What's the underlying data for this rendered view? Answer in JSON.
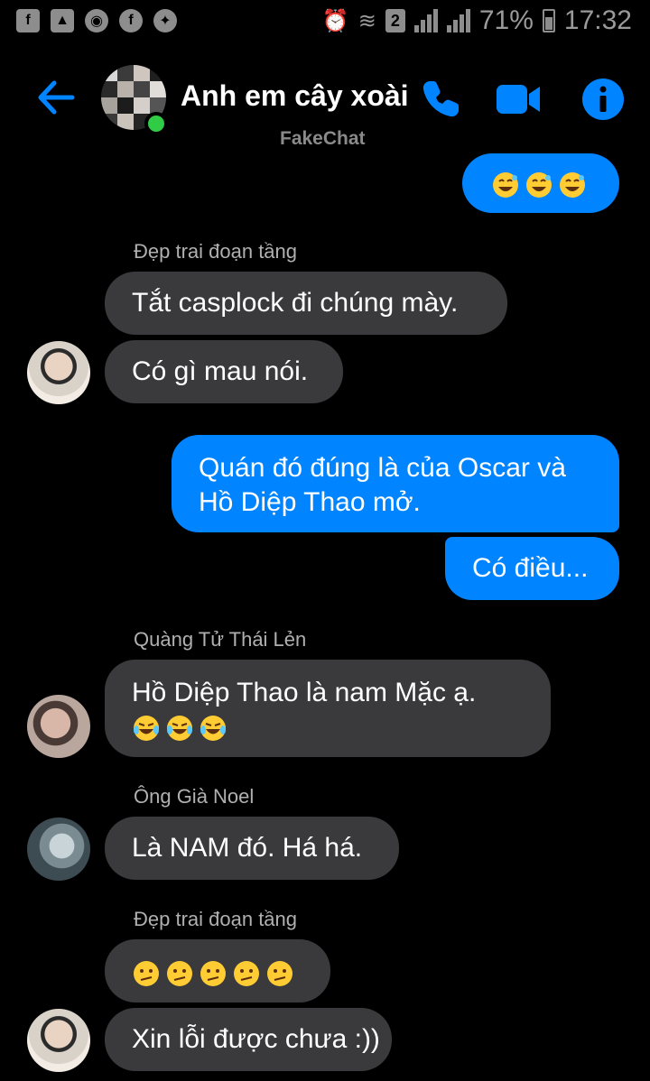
{
  "status_bar": {
    "battery": "71%",
    "time": "17:32",
    "sim_slot": "2",
    "left_icons": [
      "facebook-icon",
      "gallery-icon",
      "chrome-icon",
      "facebook-icon",
      "messenger-icon"
    ]
  },
  "header": {
    "title": "Anh em cây xoài",
    "subtitle": "FakeChat"
  },
  "colors": {
    "accent": "#0084ff",
    "incoming_bubble": "#3a3a3c",
    "online": "#31cc46",
    "background": "#000000"
  },
  "messages": {
    "m0": {
      "emoji": [
        "grinning-sweat-emoji",
        "grinning-sweat-emoji",
        "grinning-sweat-emoji"
      ]
    },
    "s1": "Đẹp trai đoạn tầng",
    "m1": "Tắt casplock đi chúng mày.",
    "m2": "Có gì mau nói.",
    "m3": "Quán đó đúng là của Oscar và",
    "m3b": "Hồ Diệp Thao mở.",
    "m4": "Có điều...",
    "s2": "Quàng Tử Thái Lẻn",
    "m5": "Hồ Diệp Thao là nam Mặc ạ.",
    "m5_emoji": [
      "tears-of-joy-emoji",
      "tears-of-joy-emoji",
      "tears-of-joy-emoji"
    ],
    "s3": "Ông Già Noel",
    "m6": "Là NAM đó. Há há.",
    "s4": "Đẹp trai đoạn tầng",
    "m7_emoji": [
      "confused-emoji",
      "confused-emoji",
      "confused-emoji",
      "confused-emoji",
      "confused-emoji"
    ],
    "m8": "Xin lỗi được chưa :))"
  }
}
